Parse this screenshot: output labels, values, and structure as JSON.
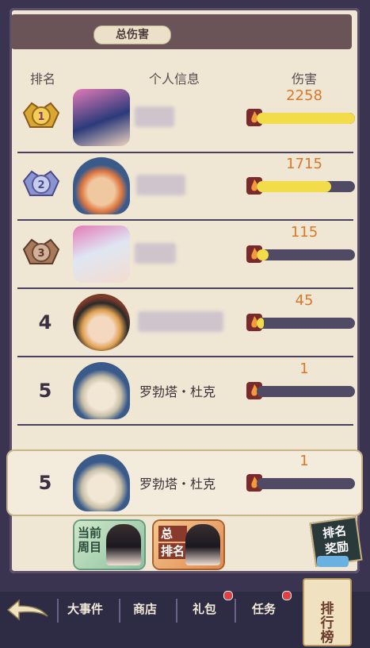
{
  "title": "总伤害",
  "headers": {
    "rank": "排名",
    "info": "个人信息",
    "damage": "伤害"
  },
  "rows": [
    {
      "rank": "1",
      "name": "",
      "damage": "2258",
      "fill": 1.0
    },
    {
      "rank": "2",
      "name": "",
      "damage": "1715",
      "fill": 0.76
    },
    {
      "rank": "3",
      "name": "",
      "damage": "115",
      "fill": 0.12
    },
    {
      "rank": "4",
      "name": "",
      "damage": "45",
      "fill": 0.07
    },
    {
      "rank": "5",
      "name": "罗勃塔・杜克",
      "damage": "1",
      "fill": 0.0
    }
  ],
  "self": {
    "rank": "5",
    "name": "罗勃塔・杜克",
    "damage": "1",
    "fill": 0.0
  },
  "tabs": {
    "current_week_line1": "当前",
    "current_week_line2": "周目",
    "total_line1": "总",
    "total_line2": "排名"
  },
  "reward": {
    "line1": "排名",
    "line2": "奖励"
  },
  "nav": {
    "events": "大事件",
    "shop": "商店",
    "gift": "礼包",
    "task": "任务",
    "ranking": "排行榜"
  },
  "colors": {
    "damage_text": "#d9772a",
    "bar_fill": "#f2dc4a",
    "bar_bg": "#514a64"
  }
}
